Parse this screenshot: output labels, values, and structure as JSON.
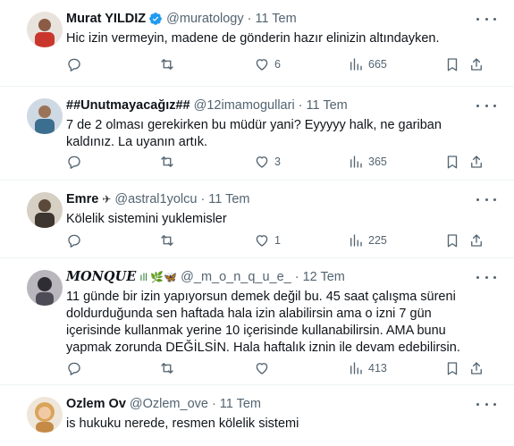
{
  "tweets": [
    {
      "name": "Murat YILDIZ",
      "handle": "@muratology",
      "sep": "·",
      "date": "11 Tem",
      "verified": true,
      "text": "Hic izin vermeyin, madene de gönderin hazır elinizin altındayken.",
      "replies": "",
      "retweets": "",
      "likes": "6",
      "views": "665",
      "avatar_color": "#c9372c"
    },
    {
      "name": "##Unutmayacağız##",
      "handle": "@12imamogullari",
      "sep": "·",
      "date": "11 Tem",
      "text": "7 de 2 olması gerekirken bu müdür yani? Eyyyyy halk, ne gariban kaldınız. La uyanın artık.",
      "replies": "",
      "retweets": "",
      "likes": "3",
      "views": "365",
      "avatar_color": "#3b6e8f"
    },
    {
      "name": "Emre",
      "name_badge": "✈",
      "handle": "@astral1yolcu",
      "sep": "·",
      "date": "11 Tem",
      "text": "Kölelik sistemini yuklemisler",
      "replies": "",
      "retweets": "",
      "likes": "1",
      "views": "225",
      "avatar_color": "#5b4a3a"
    },
    {
      "name": "𝑴𝑶𝑵𝑸𝑼𝑬",
      "name_badge": "ıll 🌿🦋",
      "handle": "@_m_o_n_q_u_e_",
      "sep": "·",
      "date": "12 Tem",
      "text": "11 günde bir izin yapıyorsun demek değil bu. 45 saat çalışma süreni doldurduğunda sen haftada hala izin alabilirsin ama o izni 7 gün içerisinde kullanmak yerine 10 içerisinde kullanabilirsin. AMA bunu yapmak zorunda DEĞİLSİN. Hala haftalık iznin ile devam edebilirsin.",
      "replies": "",
      "retweets": "",
      "likes": "",
      "views": "413",
      "avatar_color": "#2d2d33"
    },
    {
      "name": "Ozlem Ov",
      "handle": "@Ozlem_ove",
      "sep": "·",
      "date": "11 Tem",
      "text": "is hukuku nerede, resmen kölelik sistemi",
      "avatar_color": "#d9a45a"
    }
  ],
  "colors": {
    "text": "#0f1419",
    "muted": "#536471",
    "verified": "#1d9bf0",
    "border": "#eff3f4"
  },
  "icons": [
    "reply-icon",
    "retweet-icon",
    "like-icon",
    "views-icon",
    "bookmark-icon",
    "share-icon",
    "verified-icon",
    "more-icon"
  ]
}
